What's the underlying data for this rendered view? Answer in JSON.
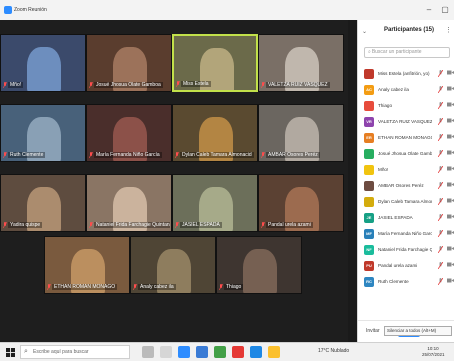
{
  "window": {
    "title": "Zoom Reunión"
  },
  "participants_panel": {
    "title": "Participantes (15)",
    "search_placeholder": "Buscar un participante",
    "participants": [
      {
        "initial": "",
        "name": "Miss Estela (anfitrión, yo)",
        "avatar_color": "#c0392b",
        "avatar_type": "photo"
      },
      {
        "initial": "AC",
        "name": "Analy cabez ila",
        "avatar_color": "#f39c12",
        "avatar_type": "initials"
      },
      {
        "initial": "",
        "name": "Thiago",
        "avatar_color": "#e74c3c",
        "avatar_type": "photo"
      },
      {
        "initial": "VR",
        "name": "VALETZA RUIZ VASQUEZ",
        "avatar_color": "#8e44ad",
        "avatar_type": "initials"
      },
      {
        "initial": "ER",
        "name": "ETHAN ROMAN MONAGO",
        "avatar_color": "#e67e22",
        "avatar_type": "initials"
      },
      {
        "initial": "",
        "name": "Josué Jhosua Olate Gamboa",
        "avatar_color": "#27ae60",
        "avatar_type": "photo"
      },
      {
        "initial": "",
        "name": "Mño!",
        "avatar_color": "#f1c40f",
        "avatar_type": "photo"
      },
      {
        "initial": "",
        "name": "AMBAR Osores Peréz",
        "avatar_color": "#6d4c41",
        "avatar_type": "photo"
      },
      {
        "initial": "",
        "name": "Dylan Caleb Tamara Almonacid",
        "avatar_color": "#d4ac0d",
        "avatar_type": "photo"
      },
      {
        "initial": "JE",
        "name": "JASIEL ESPADA",
        "avatar_color": "#16a085",
        "avatar_type": "initials"
      },
      {
        "initial": "MF",
        "name": "María Fernanda Niño García",
        "avatar_color": "#2980b9",
        "avatar_type": "initials"
      },
      {
        "initial": "NF",
        "name": "Nataniel Frida Farchagie Quint...",
        "avatar_color": "#1abc9c",
        "avatar_type": "initials"
      },
      {
        "initial": "PU",
        "name": "Pandal urela azami",
        "avatar_color": "#c0392b",
        "avatar_type": "initials"
      },
      {
        "initial": "RC",
        "name": "Ruth Clemente",
        "avatar_color": "#2e86c1",
        "avatar_type": "initials"
      }
    ],
    "invite_label": "Invitar",
    "mute_all_label": "Silenciar a todos",
    "tooltip": "Silenciar a todos (Alt+M)"
  },
  "gallery": {
    "tiles": [
      {
        "name": "Mño!",
        "bg": "#3b4a6b",
        "accent": "#7fa6d9"
      },
      {
        "name": "Josué Jhosua Olate Gamboa",
        "bg": "#5a3d2e",
        "accent": "#b3846a"
      },
      {
        "name": "Miss Estela",
        "bg": "#6b6a4a",
        "accent": "#c9b98b",
        "active": true
      },
      {
        "name": "VALETZA RUIZ VASQUEZ",
        "bg": "#7a6f66",
        "accent": "#d8cfc6"
      },
      {
        "name": "Ruth Clemente",
        "bg": "#48617a",
        "accent": "#9fb6c9"
      },
      {
        "name": "María Fernanda Niño García",
        "bg": "#4a2e2b",
        "accent": "#a35d54"
      },
      {
        "name": "Dylan Caleb Tamara Almonacid",
        "bg": "#5a4a30",
        "accent": "#d19a4a"
      },
      {
        "name": "AMBAR Osores Peréz",
        "bg": "#6b6660",
        "accent": "#c8c0b6"
      },
      {
        "name": "Yadira quispe",
        "bg": "#5e4c3f",
        "accent": "#c6a27f"
      },
      {
        "name": "Nataniel Frida Farchagie Quintana",
        "bg": "#8a7564",
        "accent": "#e0c8b0"
      },
      {
        "name": "JASIEL ESPADA",
        "bg": "#6c6f5a",
        "accent": "#b9bd9a"
      },
      {
        "name": "Pandal urela azami",
        "bg": "#5b4133",
        "accent": "#b27a5a"
      },
      {
        "name": "ETHAN ROMAN MONAGO",
        "bg": "#7a5a3e",
        "accent": "#d2a26b"
      },
      {
        "name": "Analy cabez ila",
        "bg": "#4f4535",
        "accent": "#a3906c"
      },
      {
        "name": "Thiago",
        "bg": "#3e3530",
        "accent": "#8a6f5e"
      }
    ]
  },
  "taskbar": {
    "search_placeholder": "Escribe aquí para buscar",
    "tray_text": "17°C  Nublado",
    "time": "10:10",
    "date": "25/07/2021"
  }
}
